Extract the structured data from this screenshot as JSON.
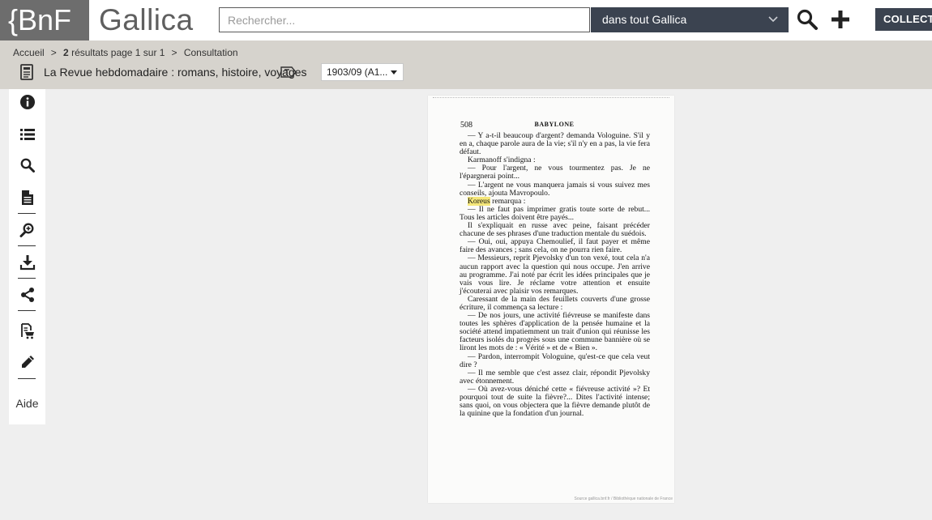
{
  "header": {
    "logo_bnf": "{BnF",
    "logo_gallica": "Gallica",
    "search_placeholder": "Rechercher...",
    "scope_label": "dans tout Gallica",
    "collections_label": "COLLECTIONS"
  },
  "breadcrumb": {
    "home": "Accueil",
    "results_count": "2",
    "results_text": "résultats page 1 sur 1",
    "current": "Consultation"
  },
  "document": {
    "title": "La Revue hebdomadaire : romans, histoire, voyages",
    "date_selected": "1903/09 (A1..."
  },
  "toolbar": {
    "items": [
      "info-icon",
      "list-icon",
      "search-icon",
      "document-icon",
      "zoom-icon",
      "download-icon",
      "share-icon",
      "cart-icon",
      "edit-icon"
    ],
    "help_label": "Aide"
  },
  "page": {
    "number": "508",
    "running_head": "BABYLONE",
    "source": "Source gallica.bnf.fr / Bibliothèque nationale de France",
    "highlight": "Koreus",
    "paragraphs": [
      "— Y a-t-il beaucoup d'argent? demanda Vologuine. S'il y en a, chaque parole aura de la vie; s'il n'y en a pas, la vie fera défaut.",
      "Karmanoff s'indigna :",
      "— Pour l'argent, ne vous tourmentez pas. Je ne l'épargnerai point...",
      "— L'argent ne vous manquera jamais si vous suivez mes conseils, ajouta Mavropoulo.",
      "remarqua :",
      "— Il ne faut pas imprimer gratis toute sorte de rebut... Tous les articles doivent être payés...",
      "Il s'expliquait en russe avec peine, faisant précéder chacune de ses phrases d'une traduction mentale du suédois.",
      "— Oui, oui, appuya Chemoulief, il faut payer et même faire des avances ; sans cela, on ne pourra rien faire.",
      "— Messieurs, reprit Pjevolsky d'un ton vexé, tout cela n'a aucun rapport avec la question qui nous occupe. J'en arrive au programme. J'ai noté par écrit les idées principales que je vais vous lire. Je réclame votre attention et ensuite j'écouterai avec plaisir vos remarques.",
      "Caressant de la main des feuillets couverts d'une grosse écriture, il commença sa lecture :",
      "— De nos jours, une activité fiévreuse se manifeste dans toutes les sphères d'application de la pensée humaine et la société attend impatiemment un trait d'union qui réunisse les facteurs isolés du progrès sous une commune bannière où se liront les mots de : « Vérité » et de « Bien ».",
      "— Pardon, interrompit Vologuine, qu'est-ce que cela veut dire ?",
      "— Il me semble que c'est assez clair, répondit Pjevolsky avec étonnement.",
      "— Où avez-vous déniché cette « fiévreuse activité »? Et pourquoi tout de suite la fièvre?... Dites l'activité intense; sans quoi, on vous objectera que la fièvre demande plutôt de la quinine que la fondation d'un journal."
    ]
  },
  "colors": {
    "logo_bg": "#6d6d6d",
    "dark_button": "#3b4350",
    "subbar_bg": "#d6d3cd",
    "highlight": "#f5e77a"
  }
}
